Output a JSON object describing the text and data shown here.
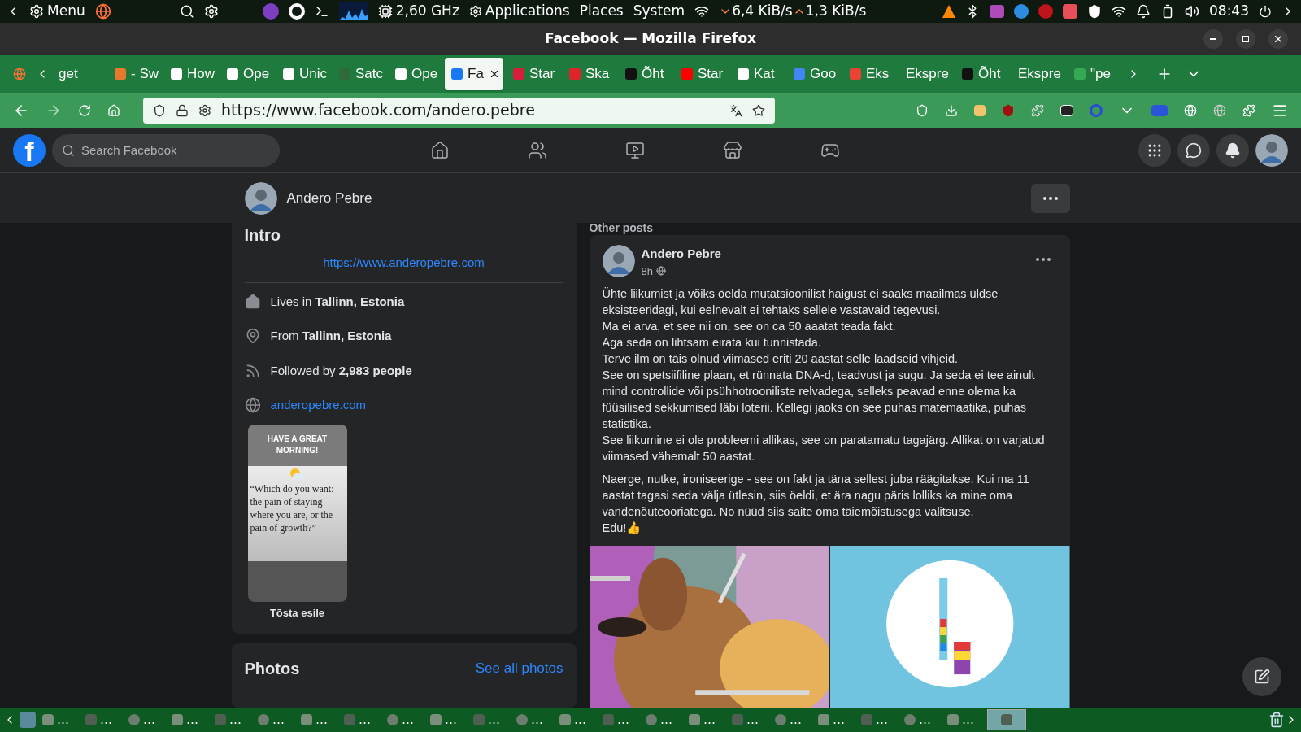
{
  "top_panel": {
    "menu": "Menu",
    "cpu": "2,60 GHz",
    "menus": [
      "Applications",
      "Places",
      "System"
    ],
    "down_speed": "6,4 KiB/s",
    "up_speed": "1,3 KiB/s",
    "clock": "08:43"
  },
  "window": {
    "title": "Facebook — Mozilla Firefox"
  },
  "tabs": [
    {
      "label": "get",
      "selected": false
    },
    {
      "label": "- Sw",
      "selected": false,
      "color": "#e8792c"
    },
    {
      "label": "How",
      "selected": false,
      "color": "#ffffff"
    },
    {
      "label": "Ope",
      "selected": false,
      "color": "#ffffff"
    },
    {
      "label": "Unic",
      "selected": false,
      "color": "#ffffff"
    },
    {
      "label": "Satc",
      "selected": false,
      "color": "#2f6b3a"
    },
    {
      "label": "Ope",
      "selected": false,
      "color": "#ffffff"
    },
    {
      "label": "Fa",
      "selected": true,
      "color": "#1877f2"
    },
    {
      "label": "Star",
      "selected": false,
      "color": "#d6203a"
    },
    {
      "label": "Ska",
      "selected": false,
      "color": "#e0242c"
    },
    {
      "label": "Õht",
      "selected": false,
      "color": "#111111"
    },
    {
      "label": "Star",
      "selected": false,
      "color": "#ff0000"
    },
    {
      "label": "Kat",
      "selected": false,
      "color": "#ffffff"
    },
    {
      "label": "Goo",
      "selected": false,
      "color": "#4285f4"
    },
    {
      "label": "Eks",
      "selected": false,
      "color": "#ea4335"
    },
    {
      "label": "Ekspre",
      "selected": false
    },
    {
      "label": "Õht",
      "selected": false,
      "color": "#111111"
    },
    {
      "label": "Ekspre",
      "selected": false
    },
    {
      "label": "\"pe",
      "selected": false,
      "color": "#34a853"
    }
  ],
  "address_bar": {
    "url": "https://www.facebook.com/andero.pebre"
  },
  "facebook_header": {
    "logo": "f",
    "search": {
      "placeholder": "Search Facebook"
    }
  },
  "profile_bar": {
    "name": "Andero Pebre"
  },
  "intro": {
    "title": "Intro",
    "bio_link": "https://www.anderopebre.com",
    "details": [
      {
        "kind": "home",
        "text": "Lives in **Tallinn, Estonia**"
      },
      {
        "kind": "pin",
        "text": "From **Tallinn, Estonia**"
      },
      {
        "kind": "followers",
        "text": "Followed by **2,983 people**"
      },
      {
        "kind": "link",
        "text": "anderopebre.com"
      }
    ],
    "featured": {
      "header": "HAVE A GREAT MORNING!",
      "quote": "“Which do you want: the pain of staying where you are, or the pain of growth?”",
      "caption": "Tõsta esile"
    }
  },
  "photos": {
    "title": "Photos",
    "see_all": "See all photos"
  },
  "other_posts": {
    "title": "Other posts",
    "post": {
      "author": "Andero Pebre",
      "time": "8h",
      "paragraphs": [
        "Ühte liikumist ja võiks öelda mutatsioonilist haigust ei saaks maailmas üldse eksisteeridagi, kui eelnevalt ei tehtaks sellele vastavaid tegevusi.\nMa ei arva, et see nii on, see on ca 50 aaatat teada fakt.\nAga seda on lihtsam eirata kui tunnistada.\nTerve ilm on täis olnud viimased eriti 20 aastat selle laadseid vihjeid.\nSee on spetsiifiline plaan, et rünnata DNA-d, teadvust ja sugu. Ja seda ei tee ainult mind controllide või psühhotrooniliste relvadega, selleks peavad enne olema ka füüsilised sekkumised läbi loterii. Kellegi jaoks on see puhas matemaatika, puhas statistika.\nSee liikumine ei ole probleemi allikas, see on paratamatu tagajärg. Allikat on varjatud viimased vähemalt 50 aastat.",
        "Naerge, nutke, ironiseerige - see on fakt ja täna sellest juba räägitakse. Kui ma 11 aastat tagasi seda välja ütlesin, siis öeldi, et ära nagu päris lolliks ka mine oma vandenõuteooriatega. No nüüd siis saite oma täiemõistusega valitsuse.\nEdu!👍"
      ],
      "images": [
        {
          "kind": "picture"
        },
        {
          "kind": "picture"
        }
      ]
    }
  },
  "taskbar": {
    "items": [
      {
        "label": "…",
        "active": false
      },
      {
        "label": "…",
        "active": false
      },
      {
        "label": "…",
        "active": false
      },
      {
        "label": "…",
        "active": false
      },
      {
        "label": "…",
        "active": false
      },
      {
        "label": "…",
        "active": false
      },
      {
        "label": "…",
        "active": false
      },
      {
        "label": "…",
        "active": false
      },
      {
        "label": "…",
        "active": false
      },
      {
        "label": "…",
        "active": false
      },
      {
        "label": "…",
        "active": false
      },
      {
        "label": "…",
        "active": false
      },
      {
        "label": "…",
        "active": false
      },
      {
        "label": "…",
        "active": false
      },
      {
        "label": "…",
        "active": false
      },
      {
        "label": "…",
        "active": false
      },
      {
        "label": "…",
        "active": false
      },
      {
        "label": "…",
        "active": false
      },
      {
        "label": "…",
        "active": false
      },
      {
        "label": "…",
        "active": false
      },
      {
        "label": "…",
        "active": false
      },
      {
        "label": "…",
        "active": false
      },
      {
        "active": true
      }
    ]
  }
}
